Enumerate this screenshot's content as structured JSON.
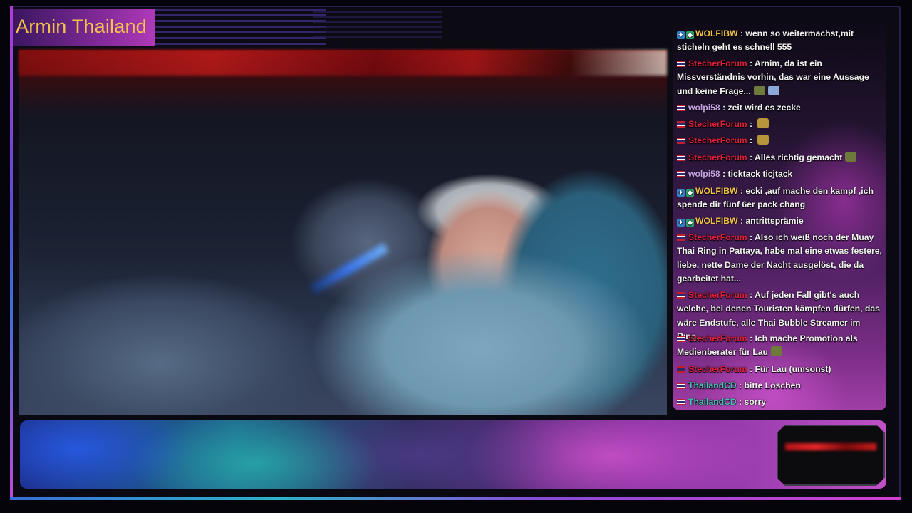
{
  "stream": {
    "title": "Armin Thailand"
  },
  "chat": {
    "messages": [
      {
        "user": "WOLFIBW",
        "user_color": "#f3c24a",
        "badges": [
          "prime",
          "sub"
        ],
        "text": " : wenn so weitermachst,mit sticheln geht es schnell 555"
      },
      {
        "user": "StecherForum",
        "user_color": "#e0203a",
        "badges": [
          "flag"
        ],
        "text": " : Arnim, da ist ein Missverständnis vorhin, das war eine Aussage und keine Frage...",
        "emotes": [
          "green-car-emote",
          "blue-emote"
        ]
      },
      {
        "user": "wolpi58",
        "user_color": "#c8a0e6",
        "badges": [
          "flag"
        ],
        "text": " : zeit wird es zecke"
      },
      {
        "user": "StecherForum",
        "user_color": "#e0203a",
        "badges": [
          "flag"
        ],
        "text": " : ",
        "emotes": [
          "gold-emote"
        ]
      },
      {
        "user": "StecherForum",
        "user_color": "#e0203a",
        "badges": [
          "flag"
        ],
        "text": " : ",
        "emotes": [
          "gold-emote"
        ]
      },
      {
        "user": "StecherForum",
        "user_color": "#e0203a",
        "badges": [
          "flag"
        ],
        "text": " : Alles richtig gemacht",
        "emotes": [
          "green-car-emote"
        ]
      },
      {
        "user": "wolpi58",
        "user_color": "#c8a0e6",
        "badges": [
          "flag"
        ],
        "text": " : ticktack ticjtack"
      },
      {
        "user": "WOLFIBW",
        "user_color": "#f3c24a",
        "badges": [
          "prime",
          "sub"
        ],
        "text": " : ecki ,auf mache den kampf ,ich spende dir fünf 6er pack chang"
      },
      {
        "user": "WOLFIBW",
        "user_color": "#f3c24a",
        "badges": [
          "prime",
          "sub"
        ],
        "text": " : antrittsprämie"
      },
      {
        "user": "StecherForum",
        "user_color": "#e0203a",
        "badges": [
          "flag"
        ],
        "text": " : Also ich weiß noch der Muay Thai Ring in Pattaya, habe mal eine etwas festere, liebe, nette Dame der Nacht ausgelöst, die da gearbeitet hat..."
      },
      {
        "user": "StecherForum",
        "user_color": "#e0203a",
        "badges": [
          "flag"
        ],
        "text": " : Auf jeden Fall gibt's auch welche, bei denen Touristen kämpfen dürfen, das wäre Endstufe, alle Thai Bubble Streamer im Ring..."
      },
      {
        "user": "StecherForum",
        "user_color": "#e0203a",
        "badges": [
          "flag"
        ],
        "text": " : Ich mache Promotion als Medienberater für Lau",
        "emotes": [
          "green-car-emote"
        ]
      },
      {
        "user": "StecherForum",
        "user_color": "#e0203a",
        "badges": [
          "flag"
        ],
        "text": " : Für Lau (umsonst)"
      },
      {
        "user": "ThailandCD",
        "user_color": "#3fc8b4",
        "badges": [
          "flag"
        ],
        "text": " : bitte Löschen"
      },
      {
        "user": "ThailandCD",
        "user_color": "#3fc8b4",
        "badges": [
          "flag"
        ],
        "text": " : sorry"
      }
    ]
  }
}
